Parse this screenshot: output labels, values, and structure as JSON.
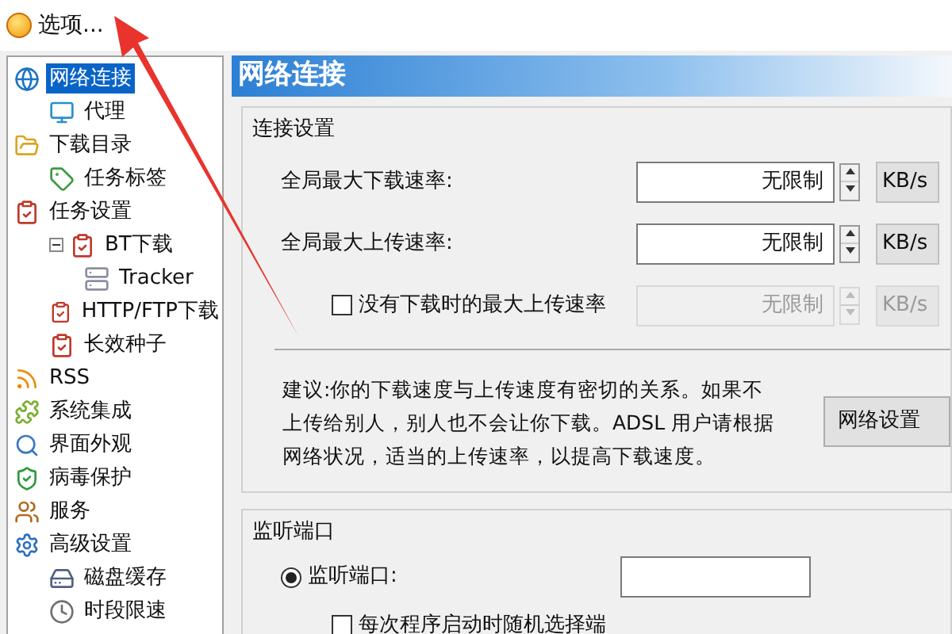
{
  "menu": {
    "label": "选项..."
  },
  "tree": [
    {
      "label": "网络连接",
      "selected": true,
      "children": [
        {
          "label": "代理",
          "selected": false
        }
      ]
    },
    {
      "label": "下载目录",
      "selected": false,
      "children": [
        {
          "label": "任务标签",
          "selected": false
        }
      ]
    },
    {
      "label": "任务设置",
      "selected": false,
      "children": [
        {
          "label": "BT下载",
          "selected": false,
          "expanded": true,
          "children": [
            {
              "label": "Tracker",
              "selected": false
            }
          ]
        },
        {
          "label": "HTTP/FTP下载",
          "selected": false
        },
        {
          "label": "长效种子",
          "selected": false
        }
      ]
    },
    {
      "label": "RSS",
      "selected": false
    },
    {
      "label": "系统集成",
      "selected": false
    },
    {
      "label": "界面外观",
      "selected": false
    },
    {
      "label": "病毒保护",
      "selected": false
    },
    {
      "label": "服务",
      "selected": false
    },
    {
      "label": "高级设置",
      "selected": false,
      "children": [
        {
          "label": "磁盘缓存",
          "selected": false
        },
        {
          "label": "时段限速",
          "selected": false
        }
      ]
    }
  ],
  "panel": {
    "title": "网络连接",
    "connection": {
      "title": "连接设置",
      "rows": [
        {
          "kind": "label",
          "label": "全局最大下载速率:",
          "value": "无限制",
          "unit": "KB/s",
          "disabled": false
        },
        {
          "kind": "label",
          "label": "全局最大上传速率:",
          "value": "无限制",
          "unit": "KB/s",
          "disabled": false
        },
        {
          "kind": "checkbox",
          "label": "没有下载时的最大上传速率",
          "checked": false,
          "value": "无限制",
          "unit": "KB/s",
          "disabled": true
        }
      ],
      "advice": "建议:你的下载速度与上传速度有密切的关系。如果不上传给别人，别人也不会让你下载。ADSL 用户请根据网络状况，适当的上传速率，以提高下载速度。",
      "button": "网络设置"
    },
    "listen": {
      "title": "监听端口",
      "radio": {
        "label": "监听端口:",
        "selected": true
      },
      "random": {
        "label": "每次程序启动时随机选择端",
        "checked": false
      }
    }
  }
}
